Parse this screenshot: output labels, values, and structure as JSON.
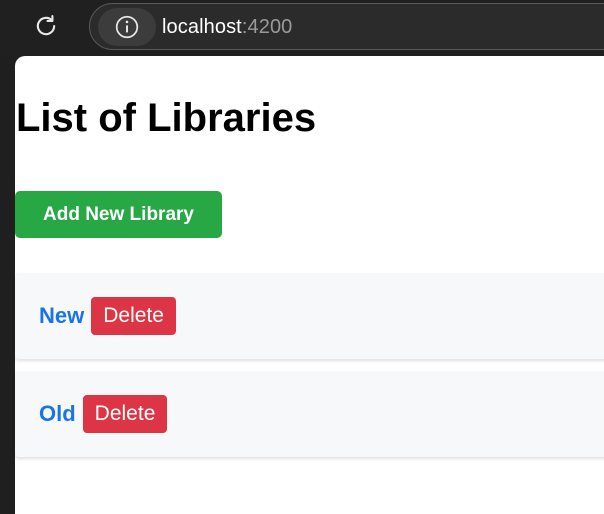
{
  "browser": {
    "url_host": "localhost",
    "url_port": ":4200"
  },
  "page": {
    "title": "List of Libraries",
    "add_button_label": "Add New Library",
    "libraries": [
      {
        "name": "New",
        "delete_label": "Delete"
      },
      {
        "name": "Old",
        "delete_label": "Delete"
      }
    ]
  },
  "colors": {
    "add_button": "#28a745",
    "delete_button": "#dc3545",
    "library_link": "#1a73e8"
  }
}
